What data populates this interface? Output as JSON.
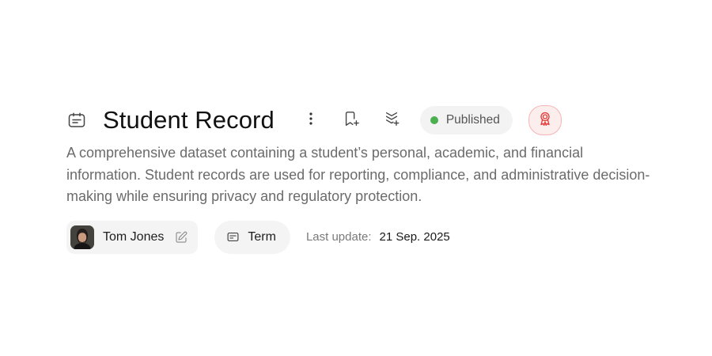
{
  "record": {
    "title": "Student Record",
    "type_icon": "document-card-icon",
    "description": "A comprehensive dataset containing a student’s personal, academic, and financial information. Student records are used for reporting, compliance, and administrative decision-making while ensuring privacy and regulatory protection."
  },
  "actions": {
    "more_icon": "more-vertical-icon",
    "bookmark_icon": "bookmark-plus-icon",
    "stack_icon": "stack-add-icon"
  },
  "status": {
    "label": "Published",
    "dot_color": "#4caf50"
  },
  "certification": {
    "icon": "award-ribbon-icon",
    "color": "#e53935"
  },
  "owner": {
    "name": "Tom Jones",
    "avatar_icon": "avatar-photo",
    "edit_icon": "pencil-icon"
  },
  "term": {
    "label": "Term",
    "icon": "term-card-icon"
  },
  "last_update": {
    "label": "Last update:",
    "value": "21 Sep. 2025"
  }
}
